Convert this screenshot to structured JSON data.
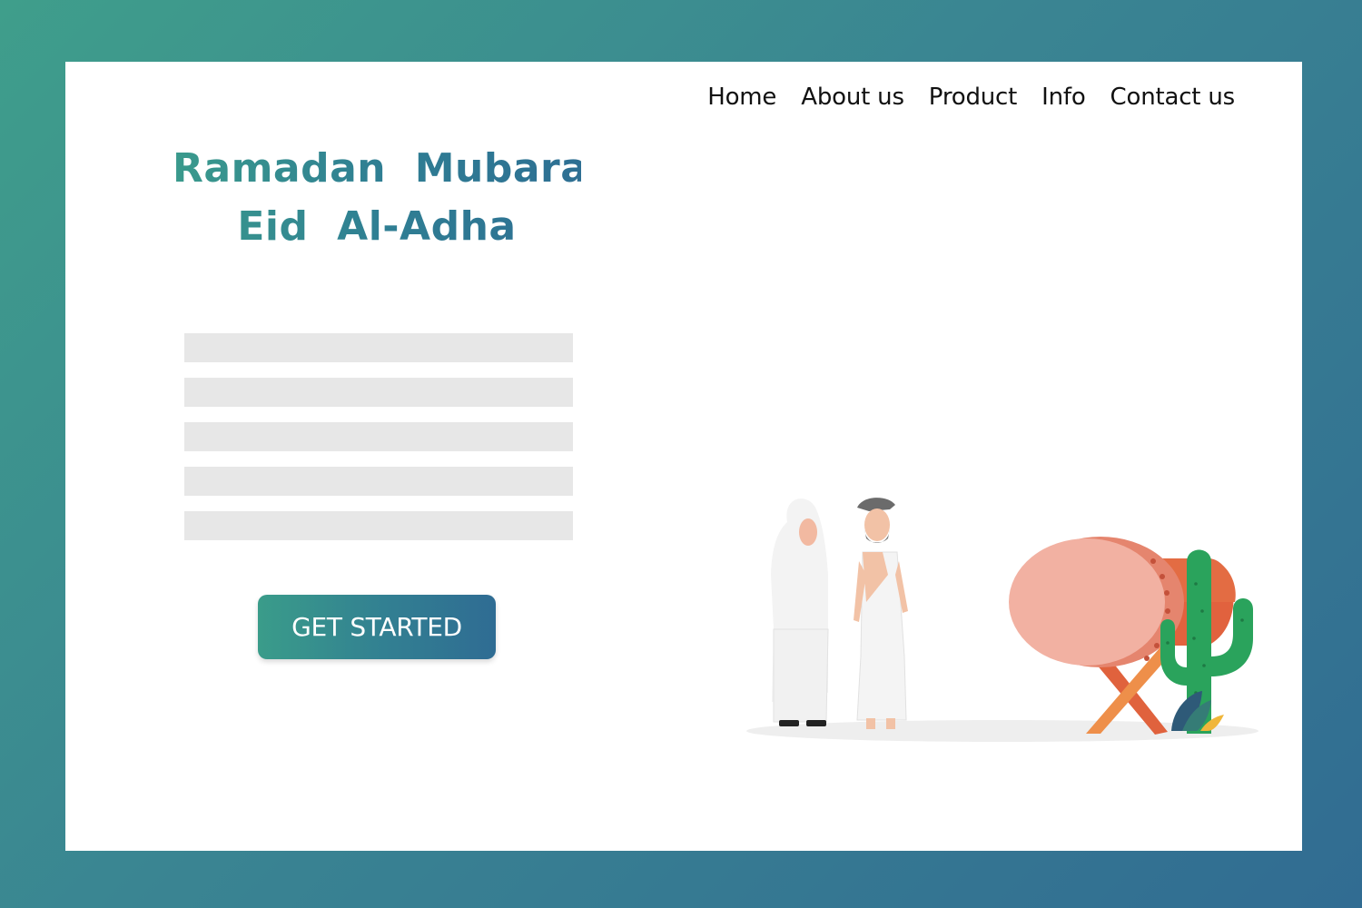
{
  "nav": {
    "items": [
      "Home",
      "About us",
      "Product",
      "Info",
      "Contact us"
    ]
  },
  "hero": {
    "title_line1": "Ramadan  Mubarak",
    "title_line2": "Eid  Al-Adha",
    "cta_label": "GET STARTED"
  },
  "placeholder_line_count": 5,
  "colors": {
    "accent_start": "#3a9c8a",
    "accent_end": "#2f6c93",
    "placeholder": "#e7e7e7",
    "drum_face": "#f2b1a2",
    "drum_body": "#e1623e",
    "cactus": "#2aa35c"
  },
  "illustration": {
    "figures": [
      "woman-hijab",
      "man-ihram"
    ],
    "objects": [
      "bedug-drum",
      "wooden-stand",
      "cactus",
      "leaf-plant"
    ]
  }
}
